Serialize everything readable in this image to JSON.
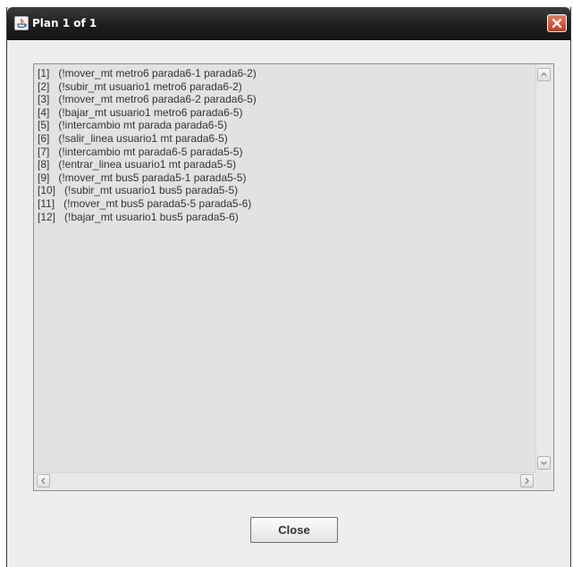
{
  "window": {
    "title": "Plan 1 of 1",
    "icon": "java-icon",
    "close_icon": "close-icon"
  },
  "plan": {
    "lines": [
      "[1]   (!mover_mt metro6 parada6-1 parada6-2)",
      "[2]   (!subir_mt usuario1 metro6 parada6-2)",
      "[3]   (!mover_mt metro6 parada6-2 parada6-5)",
      "[4]   (!bajar_mt usuario1 metro6 parada6-5)",
      "[5]   (!intercambio mt parada parada6-5)",
      "[6]   (!salir_linea usuario1 mt parada6-5)",
      "[7]   (!intercambio mt parada6-5 parada5-5)",
      "[8]   (!entrar_linea usuario1 mt parada5-5)",
      "[9]   (!mover_mt bus5 parada5-1 parada5-5)",
      "[10]   (!subir_mt usuario1 bus5 parada5-5)",
      "[11]   (!mover_mt bus5 parada5-5 parada5-6)",
      "[12]   (!bajar_mt usuario1 bus5 parada5-6)"
    ]
  },
  "scrollbars": {
    "up_icon": "chevron-up-icon",
    "down_icon": "chevron-down-icon",
    "left_icon": "chevron-left-icon",
    "right_icon": "chevron-right-icon"
  },
  "footer": {
    "close_label": "Close"
  },
  "colors": {
    "titlebar": "#1e1e1e",
    "close_button": "#d9502f",
    "textarea_bg": "#e2e2e2",
    "window_bg": "#eeeeee"
  }
}
